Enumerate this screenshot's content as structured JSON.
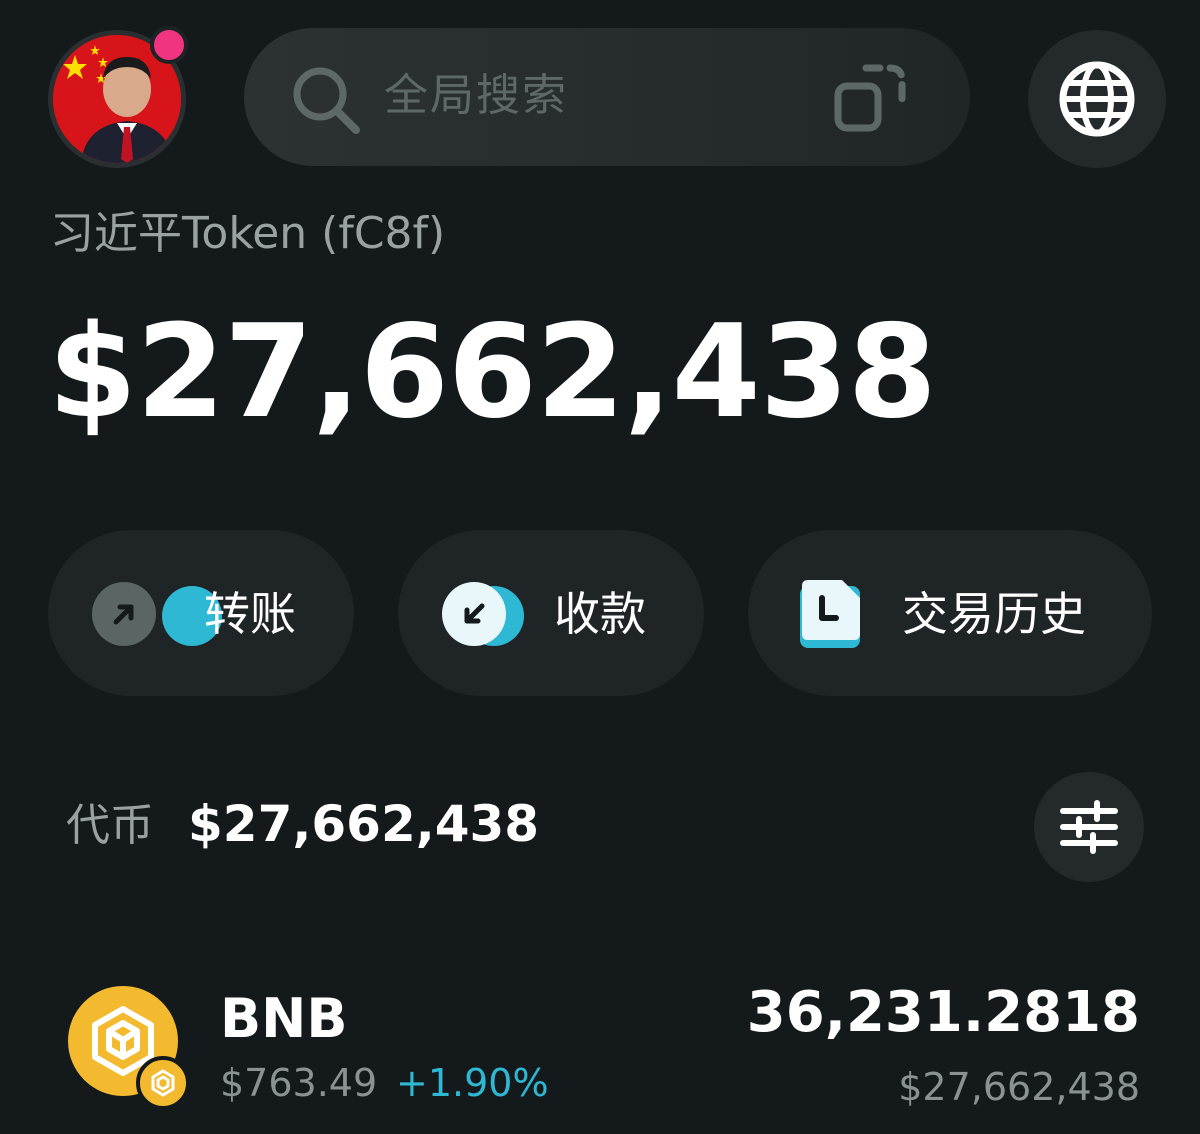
{
  "header": {
    "avatar_icon": "profile-avatar",
    "notification_color": "#f0347f",
    "search": {
      "placeholder": "全局搜索",
      "search_icon": "search-icon",
      "scan_icon": "scan-icon"
    },
    "globe_icon": "globe-icon"
  },
  "account": {
    "name": "习近平Token (fC8f)",
    "total_balance": "$27,662,438"
  },
  "actions": [
    {
      "label": "转账",
      "icon": "arrow-up-right-icon"
    },
    {
      "label": "收款",
      "icon": "arrow-down-left-icon"
    },
    {
      "label": "交易历史",
      "icon": "history-document-icon"
    }
  ],
  "tokens": {
    "label": "代币",
    "total": "$27,662,438",
    "filter_icon": "filter-sliders-icon",
    "items": [
      {
        "symbol": "BNB",
        "price": "$763.49",
        "change": "+1.90%",
        "amount": "36,231.2818",
        "value": "$27,662,438"
      }
    ]
  },
  "colors": {
    "background": "#141a1b",
    "accent": "#2fb8d3",
    "bnb": "#f3ba2f"
  }
}
